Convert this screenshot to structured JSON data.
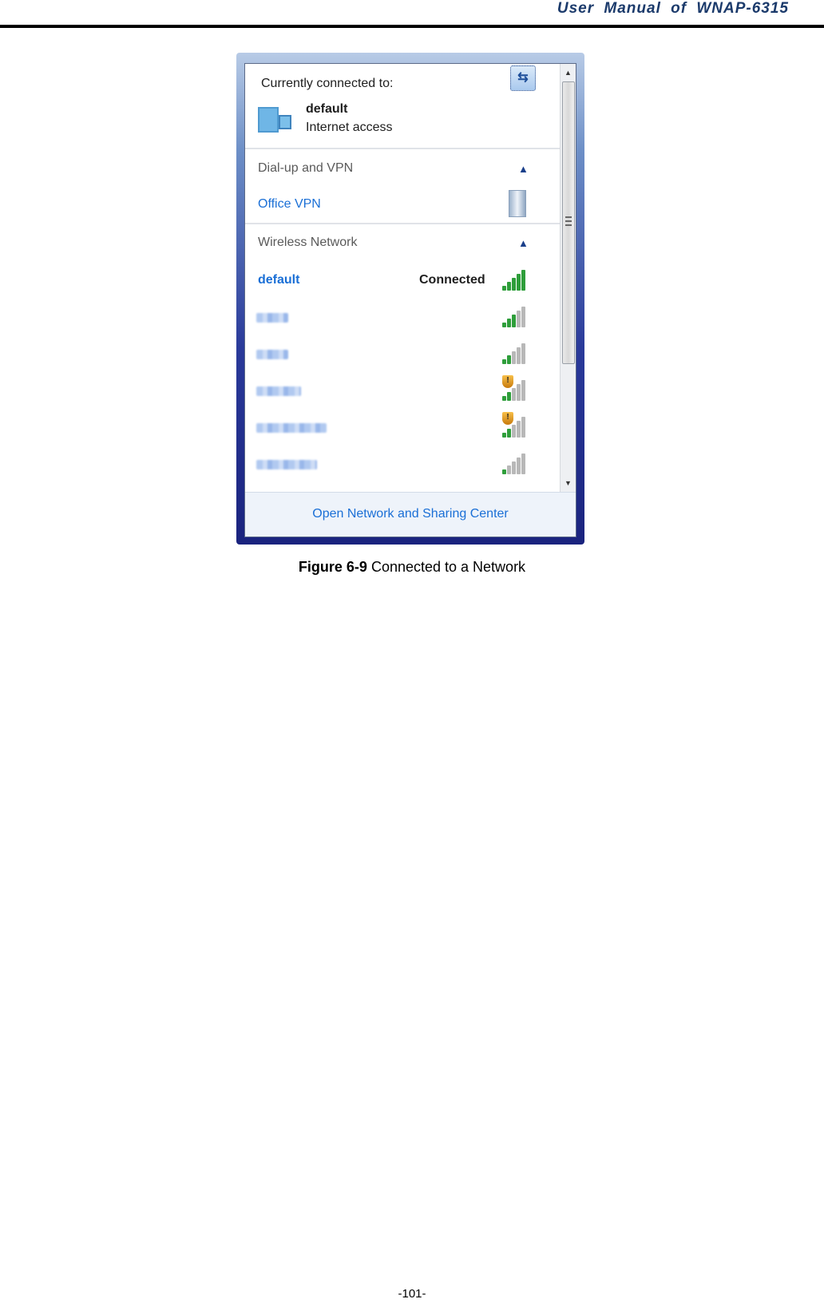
{
  "header": {
    "title": "User  Manual  of  WNAP-6315"
  },
  "popup": {
    "currently_connected_label": "Currently connected to:",
    "current_network": {
      "name": "default",
      "status": "Internet access"
    },
    "refresh_icon": "refresh-arrows-icon",
    "sections": [
      {
        "title": "Dial-up and VPN",
        "collapse_icon": "chevron-up-icon",
        "items": [
          {
            "name": "Office VPN",
            "icon": "vpn-server-icon"
          }
        ]
      },
      {
        "title": "Wireless Network",
        "collapse_icon": "chevron-up-icon"
      }
    ],
    "wireless": [
      {
        "name": "default",
        "status": "Connected",
        "signal": 5,
        "secured_warning": false,
        "blurred": false
      },
      {
        "name": "(blurred)",
        "status": "",
        "signal": 3,
        "secured_warning": false,
        "blurred": true
      },
      {
        "name": "(blurred)",
        "status": "",
        "signal": 2,
        "secured_warning": false,
        "blurred": true
      },
      {
        "name": "(blurred)",
        "status": "",
        "signal": 2,
        "secured_warning": true,
        "blurred": true
      },
      {
        "name": "(blurred)",
        "status": "",
        "signal": 2,
        "secured_warning": true,
        "blurred": true
      },
      {
        "name": "(blurred)",
        "status": "",
        "signal": 1,
        "secured_warning": false,
        "blurred": true
      }
    ],
    "footer_link": "Open Network and Sharing Center",
    "scrollbar": {
      "up": "▲",
      "down": "▼"
    }
  },
  "caption": {
    "label": "Figure 6-9",
    "text": " Connected to a Network"
  },
  "page_number": "-101-",
  "colors": {
    "link": "#1a6fd6",
    "signal_on": "#2e9e3a",
    "signal_off": "#b8b8b8",
    "header_text": "#1b3a6b"
  }
}
